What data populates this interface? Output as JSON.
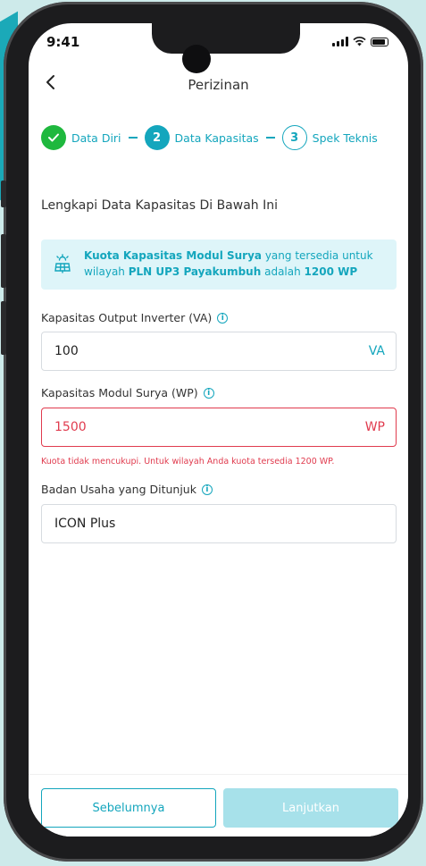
{
  "status_bar": {
    "time": "9:41"
  },
  "header": {
    "title": "Perizinan"
  },
  "stepper": [
    {
      "label": "Data Diri",
      "state": "done",
      "marker": "✓"
    },
    {
      "label": "Data Kapasitas",
      "state": "active",
      "marker": "2"
    },
    {
      "label": "Spek Teknis",
      "state": "todo",
      "marker": "3"
    }
  ],
  "section_title": "Lengkapi Data Kapasitas Di Bawah Ini",
  "info": {
    "bold1": "Kuota Kapasitas Modul Surya",
    "text1": " yang tersedia untuk wilayah ",
    "bold2": "PLN UP3 Payakumbuh",
    "text2": " adalah ",
    "bold3": "1200 WP"
  },
  "fields": {
    "inverter": {
      "label": "Kapasitas Output Inverter (VA)",
      "value": "100",
      "unit": "VA"
    },
    "module": {
      "label": "Kapasitas Modul Surya (WP)",
      "value": "1500",
      "unit": "WP",
      "error": "Kuota tidak mencukupi. Untuk wilayah Anda kuota tersedia 1200 WP."
    },
    "company": {
      "label": "Badan Usaha yang Ditunjuk",
      "value": "ICON Plus"
    }
  },
  "buttons": {
    "prev": "Sebelumnya",
    "next": "Lanjutkan"
  },
  "colors": {
    "primary": "#14a6bd",
    "success": "#1fb83e",
    "error": "#e03b4e",
    "disabled": "#a7e1ea"
  }
}
